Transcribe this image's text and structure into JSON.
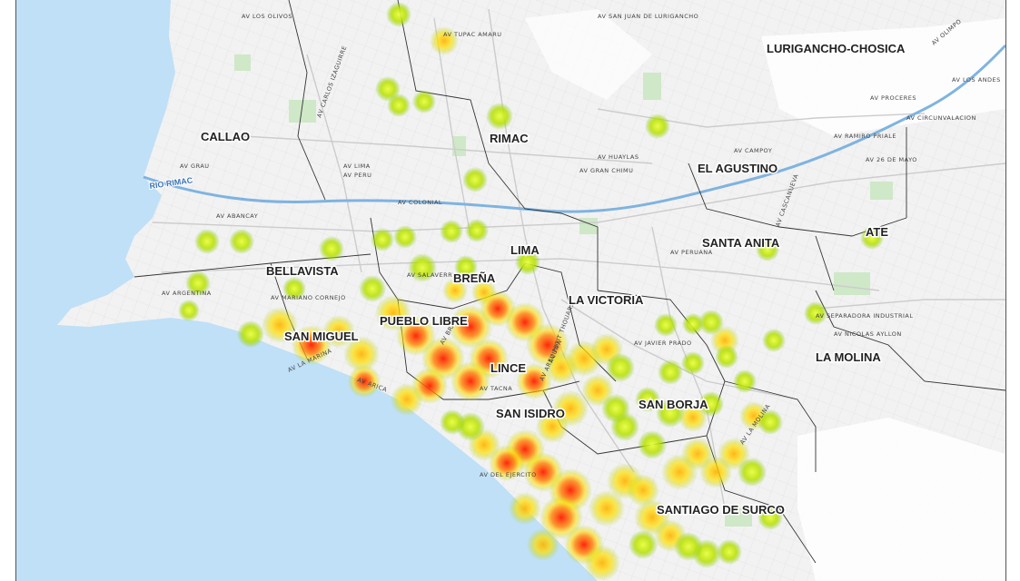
{
  "map": {
    "colors": {
      "ocean": "#bfe0f7",
      "land": "#f2f2f2",
      "parks": "#cfe8c8",
      "streets": "#d6d6d6",
      "boundaries": "#333333",
      "river": "#7fb3e0",
      "heat_low": "#a8d000",
      "heat_mid": "#ffe000",
      "heat_high": "#ff1a00"
    },
    "districts": [
      "CALLAO",
      "RIMAC",
      "LURIGANCHO-CHOSICA",
      "EL AGUSTINO",
      "SANTA ANITA",
      "ATE",
      "BELLAVISTA",
      "LIMA",
      "BREÑA",
      "LA VICTORIA",
      "PUEBLO LIBRE",
      "SAN MIGUEL",
      "LINCE",
      "SAN ISIDRO",
      "SAN BORJA",
      "LA MOLINA",
      "SANTIAGO DE SURCO"
    ],
    "river_label": "RIO RIMAC",
    "streets": [
      "AV COLONIAL",
      "AV ARGENTINA",
      "AV PERU",
      "AV LIMA",
      "AV GRAU",
      "AV ABANCAY",
      "AV BRASIL",
      "AV AREQUIPA",
      "AV JAVIER PRADO",
      "AV LA MARINA",
      "AV PETIT THOUARS",
      "AV ARICA",
      "AV TACNA",
      "AV DEL EJERCITO",
      "AV LA MOLINA",
      "AV SEPARADORA INDUSTRIAL",
      "AV NICOLAS AYLLON",
      "AV CASCANUEVA",
      "AV SAN JUAN DE LURIGANCHO",
      "AV GRAN CHIMU",
      "AV HUAYLAS",
      "AV LOS OLIVOS",
      "AV CARLOS IZAGUIRRE",
      "AV TUPAC AMARU",
      "AV PERUANA",
      "AV 26 DE MAYO",
      "AV CAMPOY",
      "AV RAMIRO PRIALE",
      "AV CIRCUNVALACION",
      "AV PROCERES",
      "AV OLIMPO",
      "AV LOS ANDES",
      "AV MARIANO CORNEJO",
      "AV SALAVERRY"
    ]
  }
}
